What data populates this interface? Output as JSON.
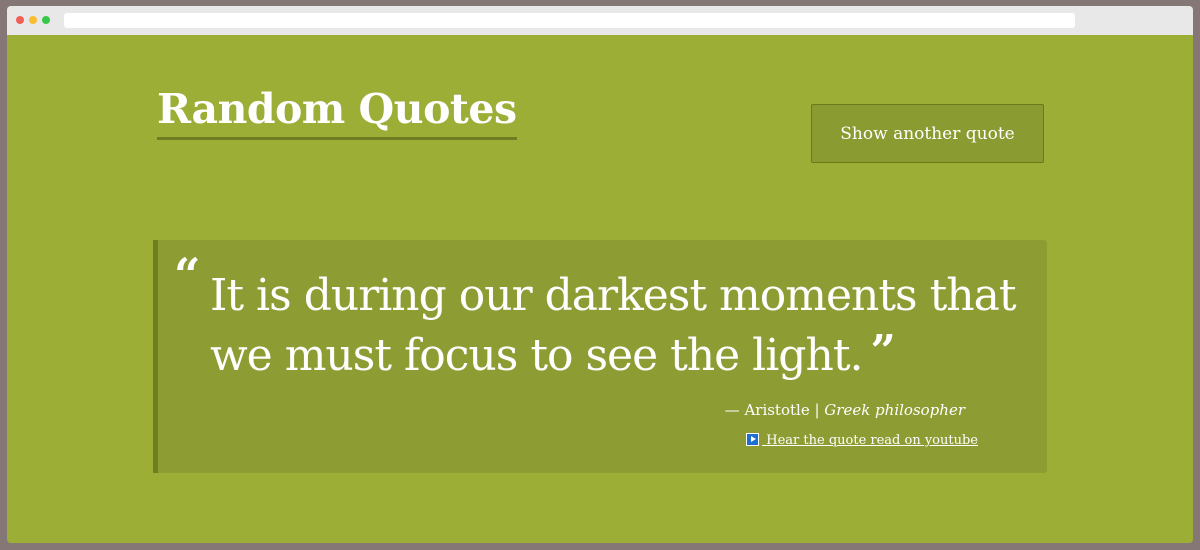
{
  "header": {
    "title": "Random Quotes",
    "button_label": "Show another quote"
  },
  "quote": {
    "open_mark": "“",
    "text": "It is during our darkest moments that we must focus to see the light.",
    "close_mark": "”",
    "dash": "— ",
    "author": "Aristotle",
    "separator": " | ",
    "role": "Greek philosopher",
    "youtube_link": " Hear the quote read on youtube",
    "youtube_icon": "play-icon"
  },
  "colors": {
    "page_background": "#9cae36",
    "quote_box": "#8d9d33",
    "accent_border": "#6e7f20",
    "button_background": "#8a9b32",
    "text": "#ffffff"
  }
}
